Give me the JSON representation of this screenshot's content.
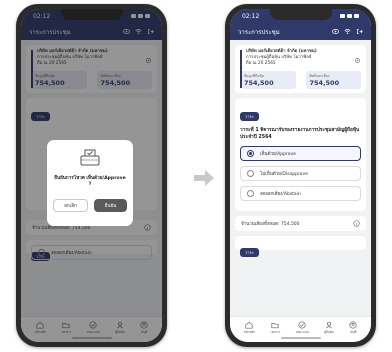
{
  "status": {
    "time": "02:12"
  },
  "appbar": {
    "title": "วาระการประชุม"
  },
  "company": {
    "name": "บริษัท มอร์เดียวสต์อ้า จำกัด (มหาชน)",
    "meeting": "การประชุมผู้ถือหุ้น บริษัท โมวาพิลส์",
    "date": "ถือ ณ 2ปี 2565",
    "stat1_label": "ข้อมูลที่ถือหุ้น",
    "stat1_value": "754,500",
    "stat2_label": "สิทธิออกเสียง",
    "stat2_value": "754,500"
  },
  "agenda": {
    "tag": "วาระ",
    "title": "วาระที่ 1 พิจารณารับรองรายงานการประชุมสามัญผู้ถือหุ้นประจำปี 2564",
    "options": [
      {
        "label": "เห็นด้วย/Approve",
        "selected": true
      },
      {
        "label": "ไม่เห็นด้วย/Disapprove",
        "selected": false
      },
      {
        "label": "งดออกเสียง/Abstain",
        "selected": false
      }
    ]
  },
  "left_visible_option": "งดออกเสียง/Abstain",
  "shares": {
    "label": "จำนวนเสียงทั้งหมด: 754,500"
  },
  "dialog": {
    "message": "ยืนยันการโหวต เห็นด้วย/Approve ?",
    "cancel": "ยกเลิก",
    "confirm": "ยืนยัน"
  },
  "tabs": [
    {
      "icon": "home-icon",
      "label": "หน้าหลัก"
    },
    {
      "icon": "folder-icon",
      "label": "เอกสาร"
    },
    {
      "icon": "vote-icon",
      "label": "ลงคะแนน"
    },
    {
      "icon": "person-icon",
      "label": "ผู้ถือหุ้น"
    },
    {
      "icon": "user-icon",
      "label": "บัญชี"
    }
  ],
  "colors": {
    "primary": "#2f3a6b",
    "background": "#f1f2f4",
    "dim": "rgba(20,20,20,0.45)"
  }
}
